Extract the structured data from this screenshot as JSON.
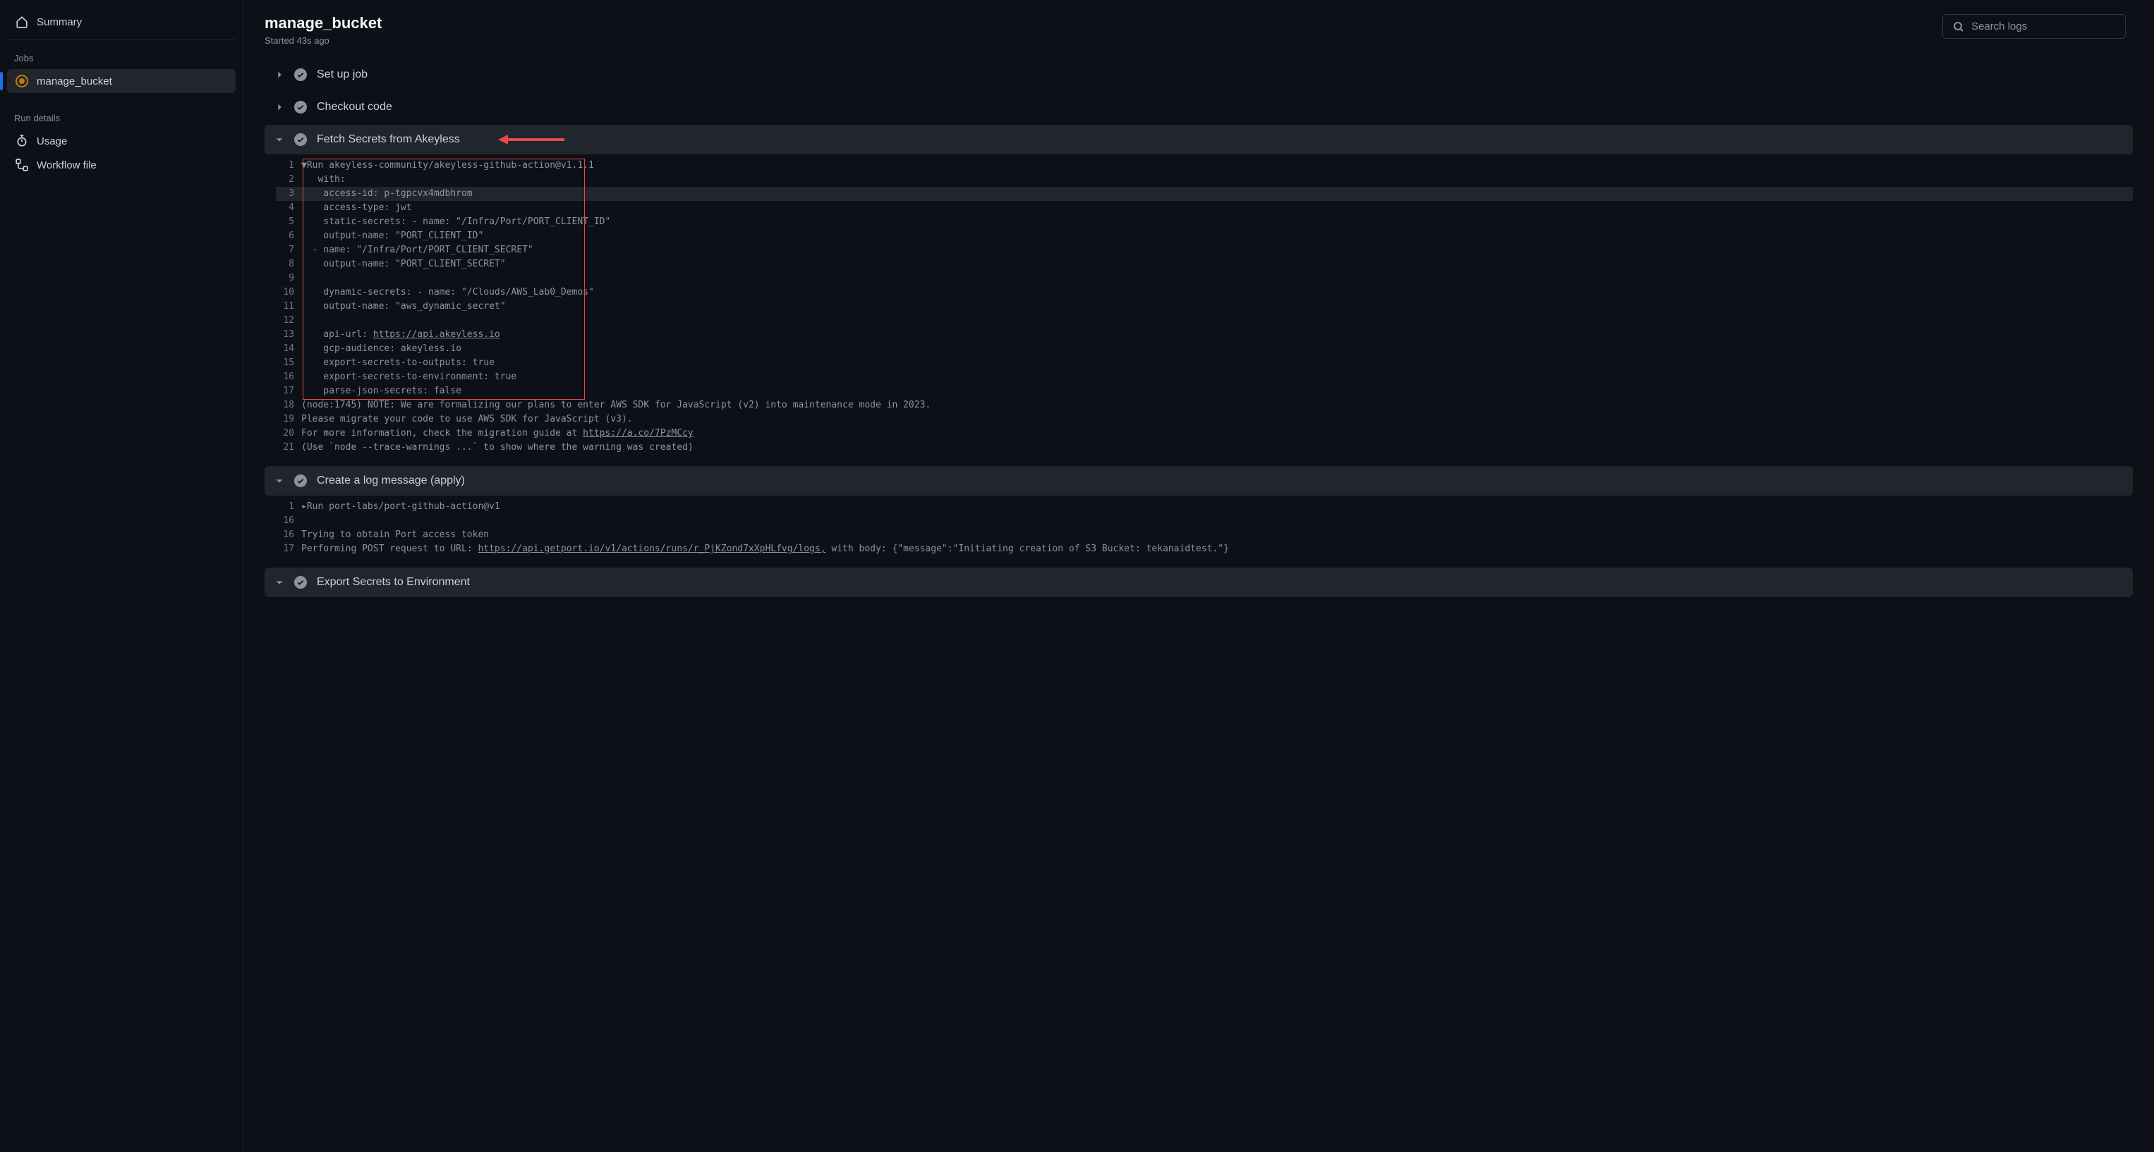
{
  "sidebar": {
    "summary_label": "Summary",
    "jobs_heading": "Jobs",
    "jobs": [
      {
        "label": "manage_bucket",
        "active": true
      }
    ],
    "run_details_heading": "Run details",
    "run_details": [
      {
        "label": "Usage",
        "icon": "stopwatch"
      },
      {
        "label": "Workflow file",
        "icon": "workflow"
      }
    ]
  },
  "header": {
    "title": "manage_bucket",
    "started": "Started 43s ago",
    "search_placeholder": "Search logs"
  },
  "steps": [
    {
      "label": "Set up job",
      "expanded": false
    },
    {
      "label": "Checkout code",
      "expanded": false
    },
    {
      "label": "Fetch Secrets from Akeyless",
      "expanded": true,
      "annotated": true,
      "log": [
        {
          "n": 1,
          "t": "▼Run akeyless-community/akeyless-github-action@v1.1.1"
        },
        {
          "n": 2,
          "t": "   with:"
        },
        {
          "n": 3,
          "t": "    access-id: p-tgpcvx4mdbhrom",
          "hl": true
        },
        {
          "n": 4,
          "t": "    access-type: jwt"
        },
        {
          "n": 5,
          "t": "    static-secrets: - name: \"/Infra/Port/PORT_CLIENT_ID\""
        },
        {
          "n": 6,
          "t": "    output-name: \"PORT_CLIENT_ID\""
        },
        {
          "n": 7,
          "t": "  - name: \"/Infra/Port/PORT_CLIENT_SECRET\""
        },
        {
          "n": 8,
          "t": "    output-name: \"PORT_CLIENT_SECRET\""
        },
        {
          "n": 9,
          "t": "    "
        },
        {
          "n": 10,
          "t": "    dynamic-secrets: - name: \"/Clouds/AWS_Lab0_Demos\""
        },
        {
          "n": 11,
          "t": "    output-name: \"aws_dynamic_secret\""
        },
        {
          "n": 12,
          "t": "    "
        },
        {
          "n": 13,
          "t": "    api-url: ",
          "link": "https://api.akeyless.io"
        },
        {
          "n": 14,
          "t": "    gcp-audience: akeyless.io"
        },
        {
          "n": 15,
          "t": "    export-secrets-to-outputs: true"
        },
        {
          "n": 16,
          "t": "    export-secrets-to-environment: true"
        },
        {
          "n": 17,
          "t": "    parse-json-secrets: false"
        },
        {
          "n": 18,
          "t": "(node:1745) NOTE: We are formalizing our plans to enter AWS SDK for JavaScript (v2) into maintenance mode in 2023."
        },
        {
          "n": 19,
          "t": "Please migrate your code to use AWS SDK for JavaScript (v3)."
        },
        {
          "n": 20,
          "t": "For more information, check the migration guide at ",
          "link": "https://a.co/7PzMCcy"
        },
        {
          "n": 21,
          "t": "(Use `node --trace-warnings ...` to show where the warning was created)"
        }
      ]
    },
    {
      "label": "Create a log message (apply)",
      "expanded": true,
      "log": [
        {
          "n": 1,
          "t": "▸Run port-labs/port-github-action@v1"
        },
        {
          "n": 16,
          "t": ""
        },
        {
          "n": 16,
          "t": "Trying to obtain Port access token"
        },
        {
          "n": 17,
          "t": "Performing POST request to URL: ",
          "link": "https://api.getport.io/v1/actions/runs/r_PjKZond7xXpHLfvg/logs,",
          "suffix": " with body: {\"message\":\"Initiating creation of S3 Bucket: tekanaidtest.\"}"
        }
      ]
    },
    {
      "label": "Export Secrets to Environment",
      "expanded": true
    }
  ]
}
